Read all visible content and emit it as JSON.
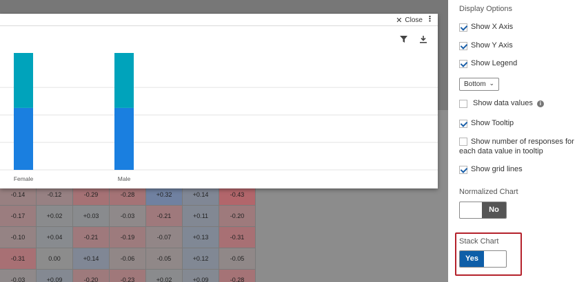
{
  "modal": {
    "close_label": "Close",
    "kebab": "⋮"
  },
  "chart_data": {
    "type": "bar",
    "stacked": true,
    "categories": [
      "Female",
      "Male"
    ],
    "series": [
      {
        "color": "#1a7fe0",
        "values": [
          0.53,
          0.53
        ]
      },
      {
        "color": "#00a3bb",
        "values": [
          0.47,
          0.47
        ]
      }
    ],
    "ylim": [
      0,
      1
    ],
    "grid": true
  },
  "heatmap": {
    "rows": [
      [
        "-0.14",
        "-0.12",
        "-0.29",
        "-0.28",
        "+0.32",
        "+0.14",
        "-0.43"
      ],
      [
        "-0.17",
        "+0.02",
        "+0.03",
        "-0.03",
        "-0.21",
        "+0.11",
        "-0.20"
      ],
      [
        "-0.10",
        "+0.04",
        "-0.21",
        "-0.19",
        "-0.07",
        "+0.13",
        "-0.31"
      ],
      [
        "-0.31",
        "0.00",
        "+0.14",
        "-0.06",
        "-0.05",
        "+0.12",
        "-0.05"
      ],
      [
        "-0.03",
        "+0.09",
        "-0.20",
        "-0.23",
        "+0.02",
        "+0.09",
        "-0.28"
      ]
    ]
  },
  "sidebar": {
    "display_options_title": "Display Options",
    "show_x_axis": "Show X Axis",
    "show_y_axis": "Show Y Axis",
    "show_legend": "Show Legend",
    "legend_position": "Bottom",
    "show_data_values": "Show data values",
    "show_tooltip": "Show Tooltip",
    "show_num_responses": "Show number of responses for each data value in tooltip",
    "show_grid_lines": "Show grid lines",
    "normalized_chart_title": "Normalized Chart",
    "normalized_value": "No",
    "stack_chart_title": "Stack Chart",
    "stack_value": "Yes",
    "accent": "#0e5ea8",
    "highlight": "#b4202a"
  }
}
